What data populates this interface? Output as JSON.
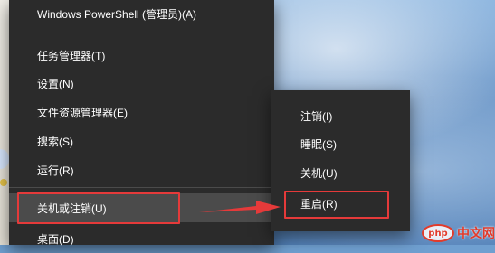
{
  "main_menu": {
    "items": [
      {
        "label": "Windows PowerShell (管理员)(A)"
      },
      {
        "label": "任务管理器(T)"
      },
      {
        "label": "设置(N)"
      },
      {
        "label": "文件资源管理器(E)"
      },
      {
        "label": "搜索(S)"
      },
      {
        "label": "运行(R)"
      },
      {
        "label": "关机或注销(U)"
      },
      {
        "label": "桌面(D)"
      }
    ],
    "submenu_caret": "›"
  },
  "sub_menu": {
    "items": [
      {
        "label": "注销(I)"
      },
      {
        "label": "睡眠(S)"
      },
      {
        "label": "关机(U)"
      },
      {
        "label": "重启(R)"
      }
    ]
  },
  "watermark": {
    "brand": "php",
    "text": "中文网"
  },
  "colors": {
    "menu_bg": "#2b2b2b",
    "hover_bg": "#4b4b4b",
    "annotation_red": "#e53a3a"
  }
}
